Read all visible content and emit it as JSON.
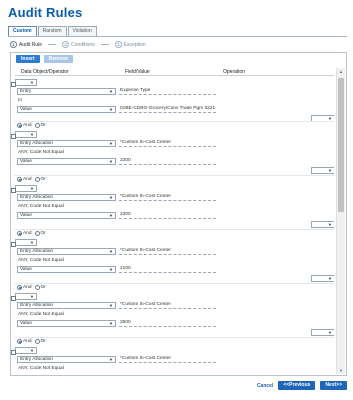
{
  "page": {
    "title": "Audit Rules"
  },
  "tabs": [
    {
      "label": "Custom",
      "active": true
    },
    {
      "label": "Random",
      "active": false
    },
    {
      "label": "Violation",
      "active": false
    }
  ],
  "steps": [
    {
      "num": "1",
      "label": "Audit Rule",
      "active": true
    },
    {
      "num": "2",
      "label": "Conditions",
      "active": false
    },
    {
      "num": "3",
      "label": "Exception",
      "active": false
    }
  ],
  "toolbar": {
    "insert_label": "Insert",
    "remove_label": "Remove"
  },
  "grid": {
    "col_data_object": "Data Object/Operator",
    "col_field_value": "Field/Value",
    "col_operation": "Operation"
  },
  "conditions": [
    {
      "entity": "Entry",
      "field": "Expense Type",
      "operator": "In",
      "value_type": "Value",
      "value": "01BE-CDBG-Grocery/Conv Trade Pgm 0221-CDB"
    },
    {
      "connector": {
        "and": "And",
        "or": "Or",
        "selected": "And"
      },
      "entity": "Entry Allocation",
      "field": "*Custom 5\\-Cost Center",
      "operator": "ANY, Code Not Equal",
      "value_type": "Value",
      "value": "2200"
    },
    {
      "connector": {
        "and": "And",
        "or": "Or",
        "selected": "And"
      },
      "entity": "Entry Allocation",
      "field": "*Custom 5\\-Cost Center",
      "operator": "ANY, Code Not Equal",
      "value_type": "Value",
      "value": "2300"
    },
    {
      "connector": {
        "and": "And",
        "or": "Or",
        "selected": "And"
      },
      "entity": "Entry Allocation",
      "field": "*Custom 5\\-Cost Center",
      "operator": "ANY, Code Not Equal",
      "value_type": "Value",
      "value": "2100"
    },
    {
      "connector": {
        "and": "And",
        "or": "Or",
        "selected": "And"
      },
      "entity": "Entry Allocation",
      "field": "*Custom 5\\-Cost Center",
      "operator": "ANY, Code Not Equal",
      "value_type": "Value",
      "value": "2500"
    },
    {
      "connector": {
        "and": "And",
        "or": "Or",
        "selected": "And"
      },
      "entity": "Entry Allocation",
      "field": "*Custom 5\\-Cost Center",
      "operator": "ANY, Code Not Equal",
      "value_type": "",
      "value": ""
    }
  ],
  "footer": {
    "cancel_label": "Cancel",
    "previous_label": "<<Previous",
    "next_label": "Next>>"
  },
  "icons": {
    "caret": "chevron-down-icon",
    "scroll_up": "arrow-up-icon",
    "scroll_down": "arrow-down-icon"
  }
}
